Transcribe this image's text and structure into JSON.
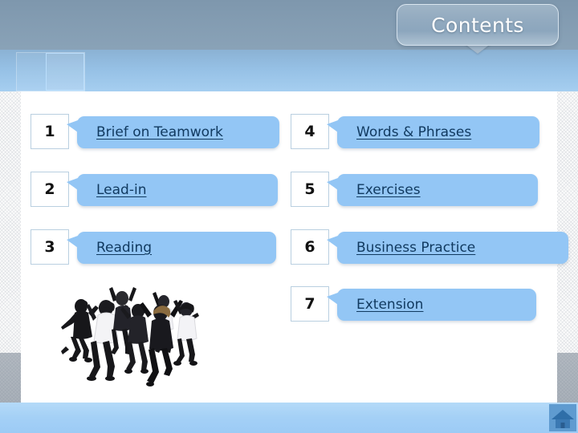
{
  "slide": {
    "title": "Contents",
    "home_icon": "home-icon"
  },
  "contents": {
    "left_column": [
      {
        "number": "1",
        "label": "Brief on Teamwork "
      },
      {
        "number": "2",
        "label": "Lead-in"
      },
      {
        "number": "3",
        "label": "Reading"
      }
    ],
    "right_column": [
      {
        "number": "4",
        "label": "Words & Phrases"
      },
      {
        "number": "5",
        "label": "Exercises"
      },
      {
        "number": "6",
        "label": "Business Practice"
      },
      {
        "number": "7",
        "label": "Extension"
      }
    ]
  },
  "image": {
    "caption": "group of business people jumping with raised arms"
  },
  "colors": {
    "bubble_fill": "#93c6f5",
    "link_text": "#10395f",
    "title_bubble": "#93abc0",
    "footer_band": "#a4d0f6",
    "home_icon_bg": "#5f9bd0"
  }
}
